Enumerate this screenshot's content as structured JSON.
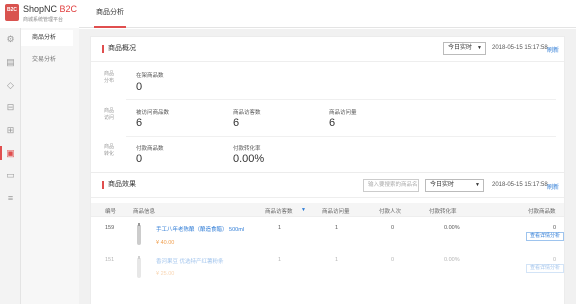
{
  "brand": {
    "logo_text": "B2C",
    "name_plain": "ShopNC ",
    "name_accent": "B2C",
    "subtitle": "商城系统管理平台"
  },
  "sidebar_icons": [
    "gear-icon",
    "list-icon",
    "tag-icon",
    "cart-icon",
    "grid-icon",
    "chart-icon",
    "box-icon",
    "settings-sliders-icon"
  ],
  "subnav": {
    "items": [
      {
        "label": "商品分析"
      },
      {
        "label": "交易分析"
      }
    ]
  },
  "topbar": {
    "tab": "商品分析"
  },
  "overview": {
    "title": "商品概况",
    "period": "今日实时",
    "datetime": "2018-05-15 15:17:58",
    "refresh": "刷新",
    "rows": [
      {
        "label": "商品分布",
        "stats": [
          {
            "label": "在架商品数",
            "value": "0"
          }
        ]
      },
      {
        "label": "商品访问",
        "stats": [
          {
            "label": "被访问商品数",
            "value": "6"
          },
          {
            "label": "商品访客数",
            "value": "6"
          },
          {
            "label": "商品访问量",
            "value": "6"
          }
        ]
      },
      {
        "label": "商品转化",
        "stats": [
          {
            "label": "付款商品数",
            "value": "0"
          },
          {
            "label": "付款转化率",
            "value": "0.00%"
          }
        ]
      }
    ]
  },
  "effect": {
    "title": "商品效果",
    "search_placeholder": "输入要搜索的商品名",
    "period": "今日实时",
    "datetime": "2018-05-15 15:17:58",
    "refresh": "刷新",
    "columns": [
      "编号",
      "商品信息",
      "商品访客数",
      "商品访问量",
      "付款人次",
      "付款转化率",
      "付款商品数"
    ],
    "sort_indicator": "▼",
    "rows": [
      {
        "id": "159",
        "name": "手工八年老陈酿（酿造食醋） 500ml",
        "price": "¥ 40.00",
        "visitors": "1",
        "views": "1",
        "buyers": "0",
        "rate": "0.00%",
        "paid_items": "0",
        "action": "查看详情分析"
      },
      {
        "id": "151",
        "name": "香河果豆 优选特产红薯粉条",
        "price": "¥ 25.00",
        "visitors": "1",
        "views": "1",
        "buyers": "0",
        "rate": "0.00%",
        "paid_items": "0",
        "action": "查看详情分析"
      }
    ]
  }
}
